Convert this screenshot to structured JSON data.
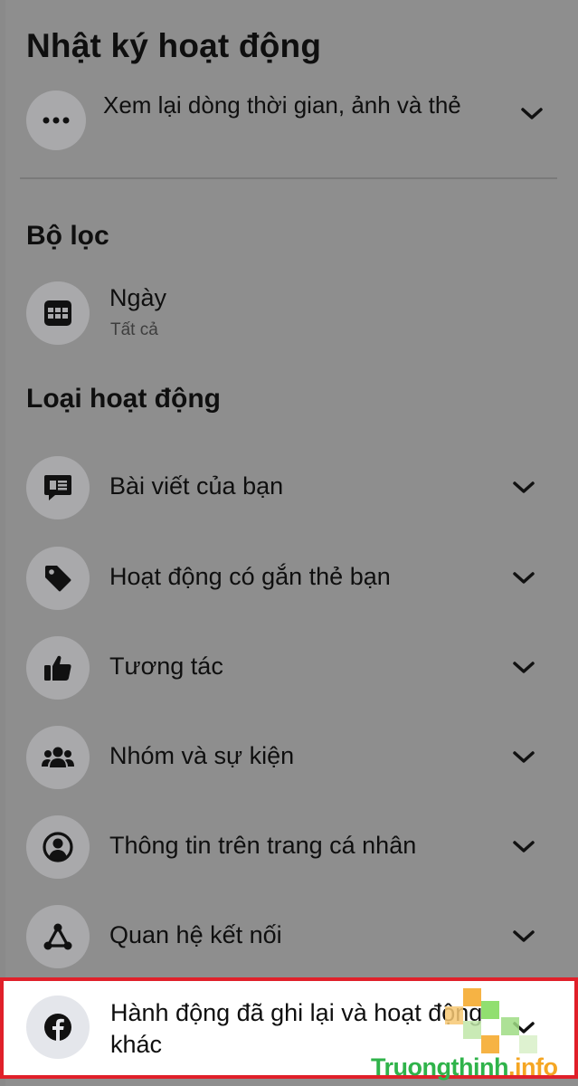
{
  "header": {
    "title": "Nhật ký hoạt động"
  },
  "review": {
    "label": "Xem lại dòng thời gian, ảnh và thẻ"
  },
  "filters": {
    "title": "Bộ lọc",
    "date_label": "Ngày",
    "date_value": "Tất cả"
  },
  "activity_types": {
    "title": "Loại hoạt động",
    "items": [
      {
        "label": "Bài viết của bạn",
        "icon": "post-icon"
      },
      {
        "label": "Hoạt động có gắn thẻ bạn",
        "icon": "tag-icon"
      },
      {
        "label": "Tương tác",
        "icon": "like-icon"
      },
      {
        "label": "Nhóm và sự kiện",
        "icon": "group-icon"
      },
      {
        "label": "Thông tin trên trang cá nhân",
        "icon": "profile-icon"
      },
      {
        "label": "Quan hệ kết nối",
        "icon": "connection-icon"
      },
      {
        "label": "Hành động đã ghi lại và hoạt động khác",
        "icon": "facebook-icon"
      }
    ]
  },
  "watermark": {
    "part1": "Truongthinh",
    "part2": ".info"
  },
  "colors": {
    "overlay": "#8e8e8e",
    "highlight_border": "#e0202a",
    "watermark_green": "#2fb34a",
    "watermark_orange": "#f5a623"
  }
}
